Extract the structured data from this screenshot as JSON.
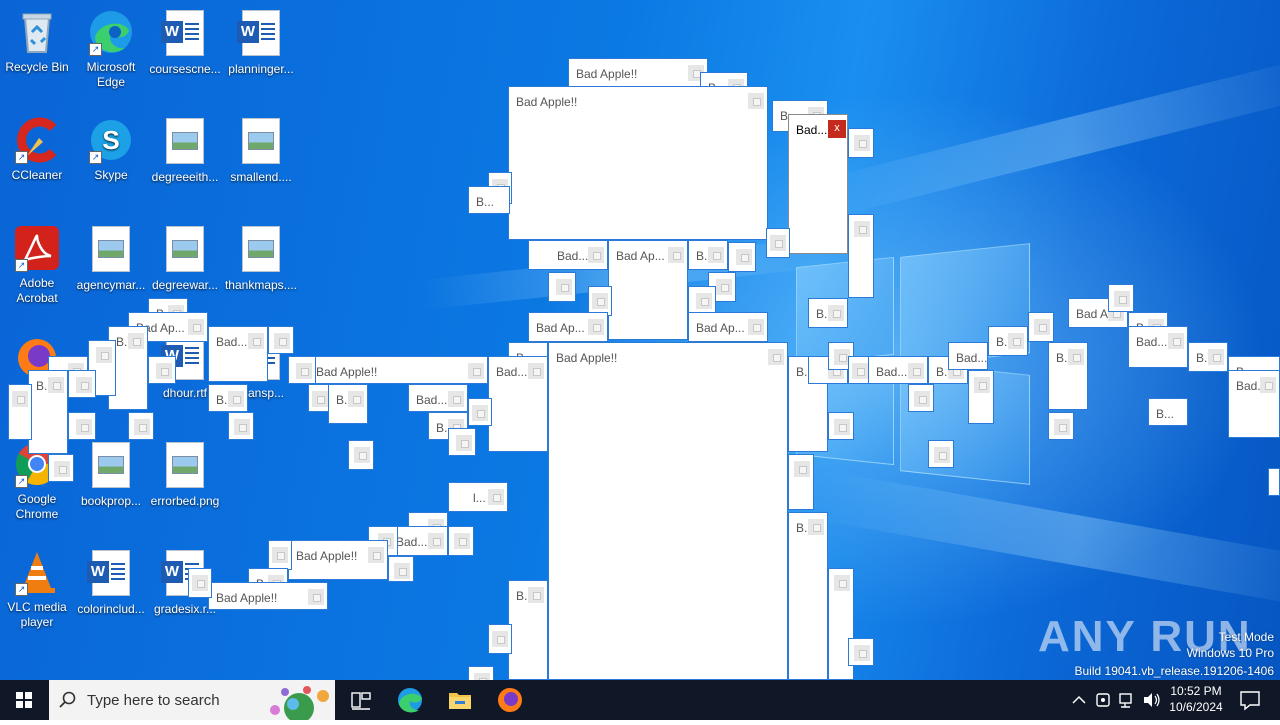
{
  "desktop_icons": [
    {
      "label": "Recycle Bin",
      "icon": "recycle-bin-icon"
    },
    {
      "label": "Microsoft Edge",
      "icon": "edge-icon"
    },
    {
      "label": "coursescne...",
      "icon": "word-doc-icon"
    },
    {
      "label": "planninger...",
      "icon": "word-doc-icon"
    },
    {
      "label": "CCleaner",
      "icon": "ccleaner-icon"
    },
    {
      "label": "Skype",
      "icon": "skype-icon"
    },
    {
      "label": "degreeeith...",
      "icon": "image-file-icon"
    },
    {
      "label": "smallend....",
      "icon": "image-file-icon"
    },
    {
      "label": "Adobe Acrobat",
      "icon": "acrobat-icon"
    },
    {
      "label": "agencymar...",
      "icon": "image-file-icon"
    },
    {
      "label": "degreewar...",
      "icon": "image-file-icon"
    },
    {
      "label": "thankmaps....",
      "icon": "image-file-icon"
    },
    {
      "label": "dhour.rtf",
      "icon": "word-doc-icon"
    },
    {
      "label": "ltransp...",
      "icon": "word-doc-icon"
    },
    {
      "label": "Google Chrome",
      "icon": "chrome-icon"
    },
    {
      "label": "bookprop...",
      "icon": "image-file-icon"
    },
    {
      "label": "errorbed.png",
      "icon": "image-file-icon"
    },
    {
      "label": "VLC media player",
      "icon": "vlc-icon"
    },
    {
      "label": "colorinclud...",
      "icon": "word-doc-icon"
    },
    {
      "label": "gradesix.r...",
      "icon": "word-doc-icon"
    }
  ],
  "message_boxes": {
    "full": "Bad Apple!!",
    "short": "Bad...",
    "mid": "Bad Ap...",
    "b": "B...",
    "l": "l..."
  },
  "watermark": {
    "brand": "ANY RUN",
    "line1": "Test Mode",
    "line2": "Windows 10 Pro",
    "line3": "Build 19041.vb_release.191206-1406"
  },
  "taskbar": {
    "search_placeholder": "Type here to search",
    "time": "10:52 PM",
    "date": "10/6/2024"
  },
  "colors": {
    "accent": "#0b79e3",
    "taskbar": "#101827",
    "close_red": "#c42b1c"
  }
}
